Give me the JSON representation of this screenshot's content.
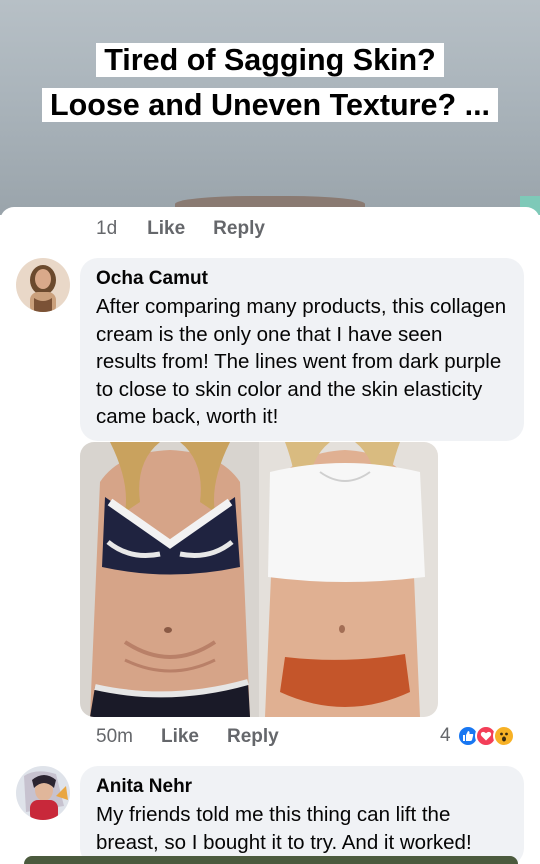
{
  "ad": {
    "headline_line1": "Tired of Sagging Skin?",
    "headline_line2": "Loose and Uneven Texture? ..."
  },
  "top_actions": {
    "time": "1d",
    "like": "Like",
    "reply": "Reply"
  },
  "comments": [
    {
      "author": "Ocha Camut",
      "text": "After comparing many products, this collagen cream is the only one that I have seen results from! The lines went from dark purple to close to skin color and the skin elasticity came back, worth it!",
      "time": "50m",
      "like": "Like",
      "reply": "Reply",
      "reaction_count": "4",
      "reactions": [
        "like-icon",
        "love-icon",
        "wow-icon"
      ]
    },
    {
      "author": "Anita Nehr",
      "text": "My friends told me this thing can lift the breast, so I bought it to try. And it worked!"
    }
  ],
  "colors": {
    "meta_text": "#65676b",
    "bubble_bg": "#f0f2f5",
    "like_blue": "#1877f2",
    "love_red": "#f33e58",
    "wow_yellow": "#f7b125"
  }
}
